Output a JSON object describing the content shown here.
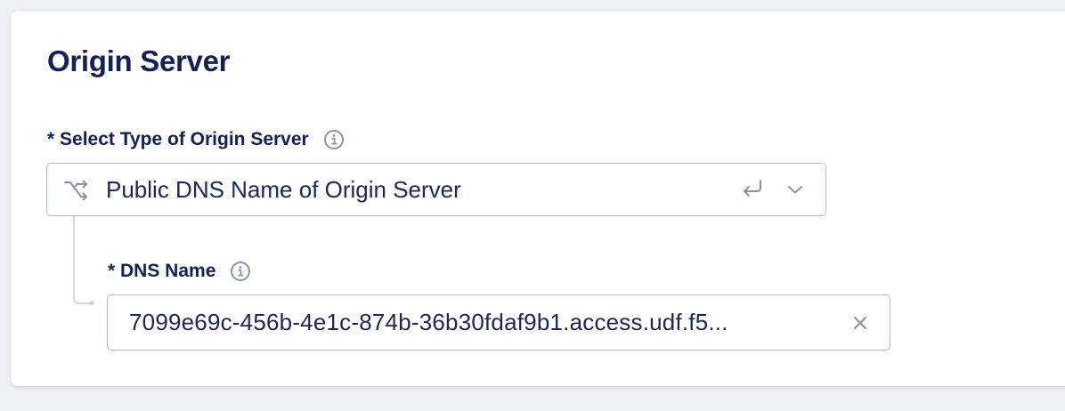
{
  "section": {
    "title": "Origin Server"
  },
  "origin_type_field": {
    "label": "* Select Type of Origin Server",
    "info_icon": "info-circle-icon",
    "type_icon": "split-arrows-icon",
    "selected_value": "Public DNS Name of Origin Server",
    "reset_icon": "return-arrow-icon",
    "chevron_icon": "chevron-down-icon"
  },
  "dns_name_field": {
    "label": "* DNS Name",
    "info_icon": "info-circle-icon",
    "value": "7099e69c-456b-4e1c-874b-36b30fdaf9b1.access.udf.f5...",
    "clear_icon": "close-icon"
  },
  "colors": {
    "heading": "#152055",
    "text": "#1d2754",
    "border": "#b4b9c6",
    "icon": "#8c93a6",
    "connector": "#d3d7df",
    "card_background": "#ffffff",
    "page_background": "#eef0f3"
  }
}
